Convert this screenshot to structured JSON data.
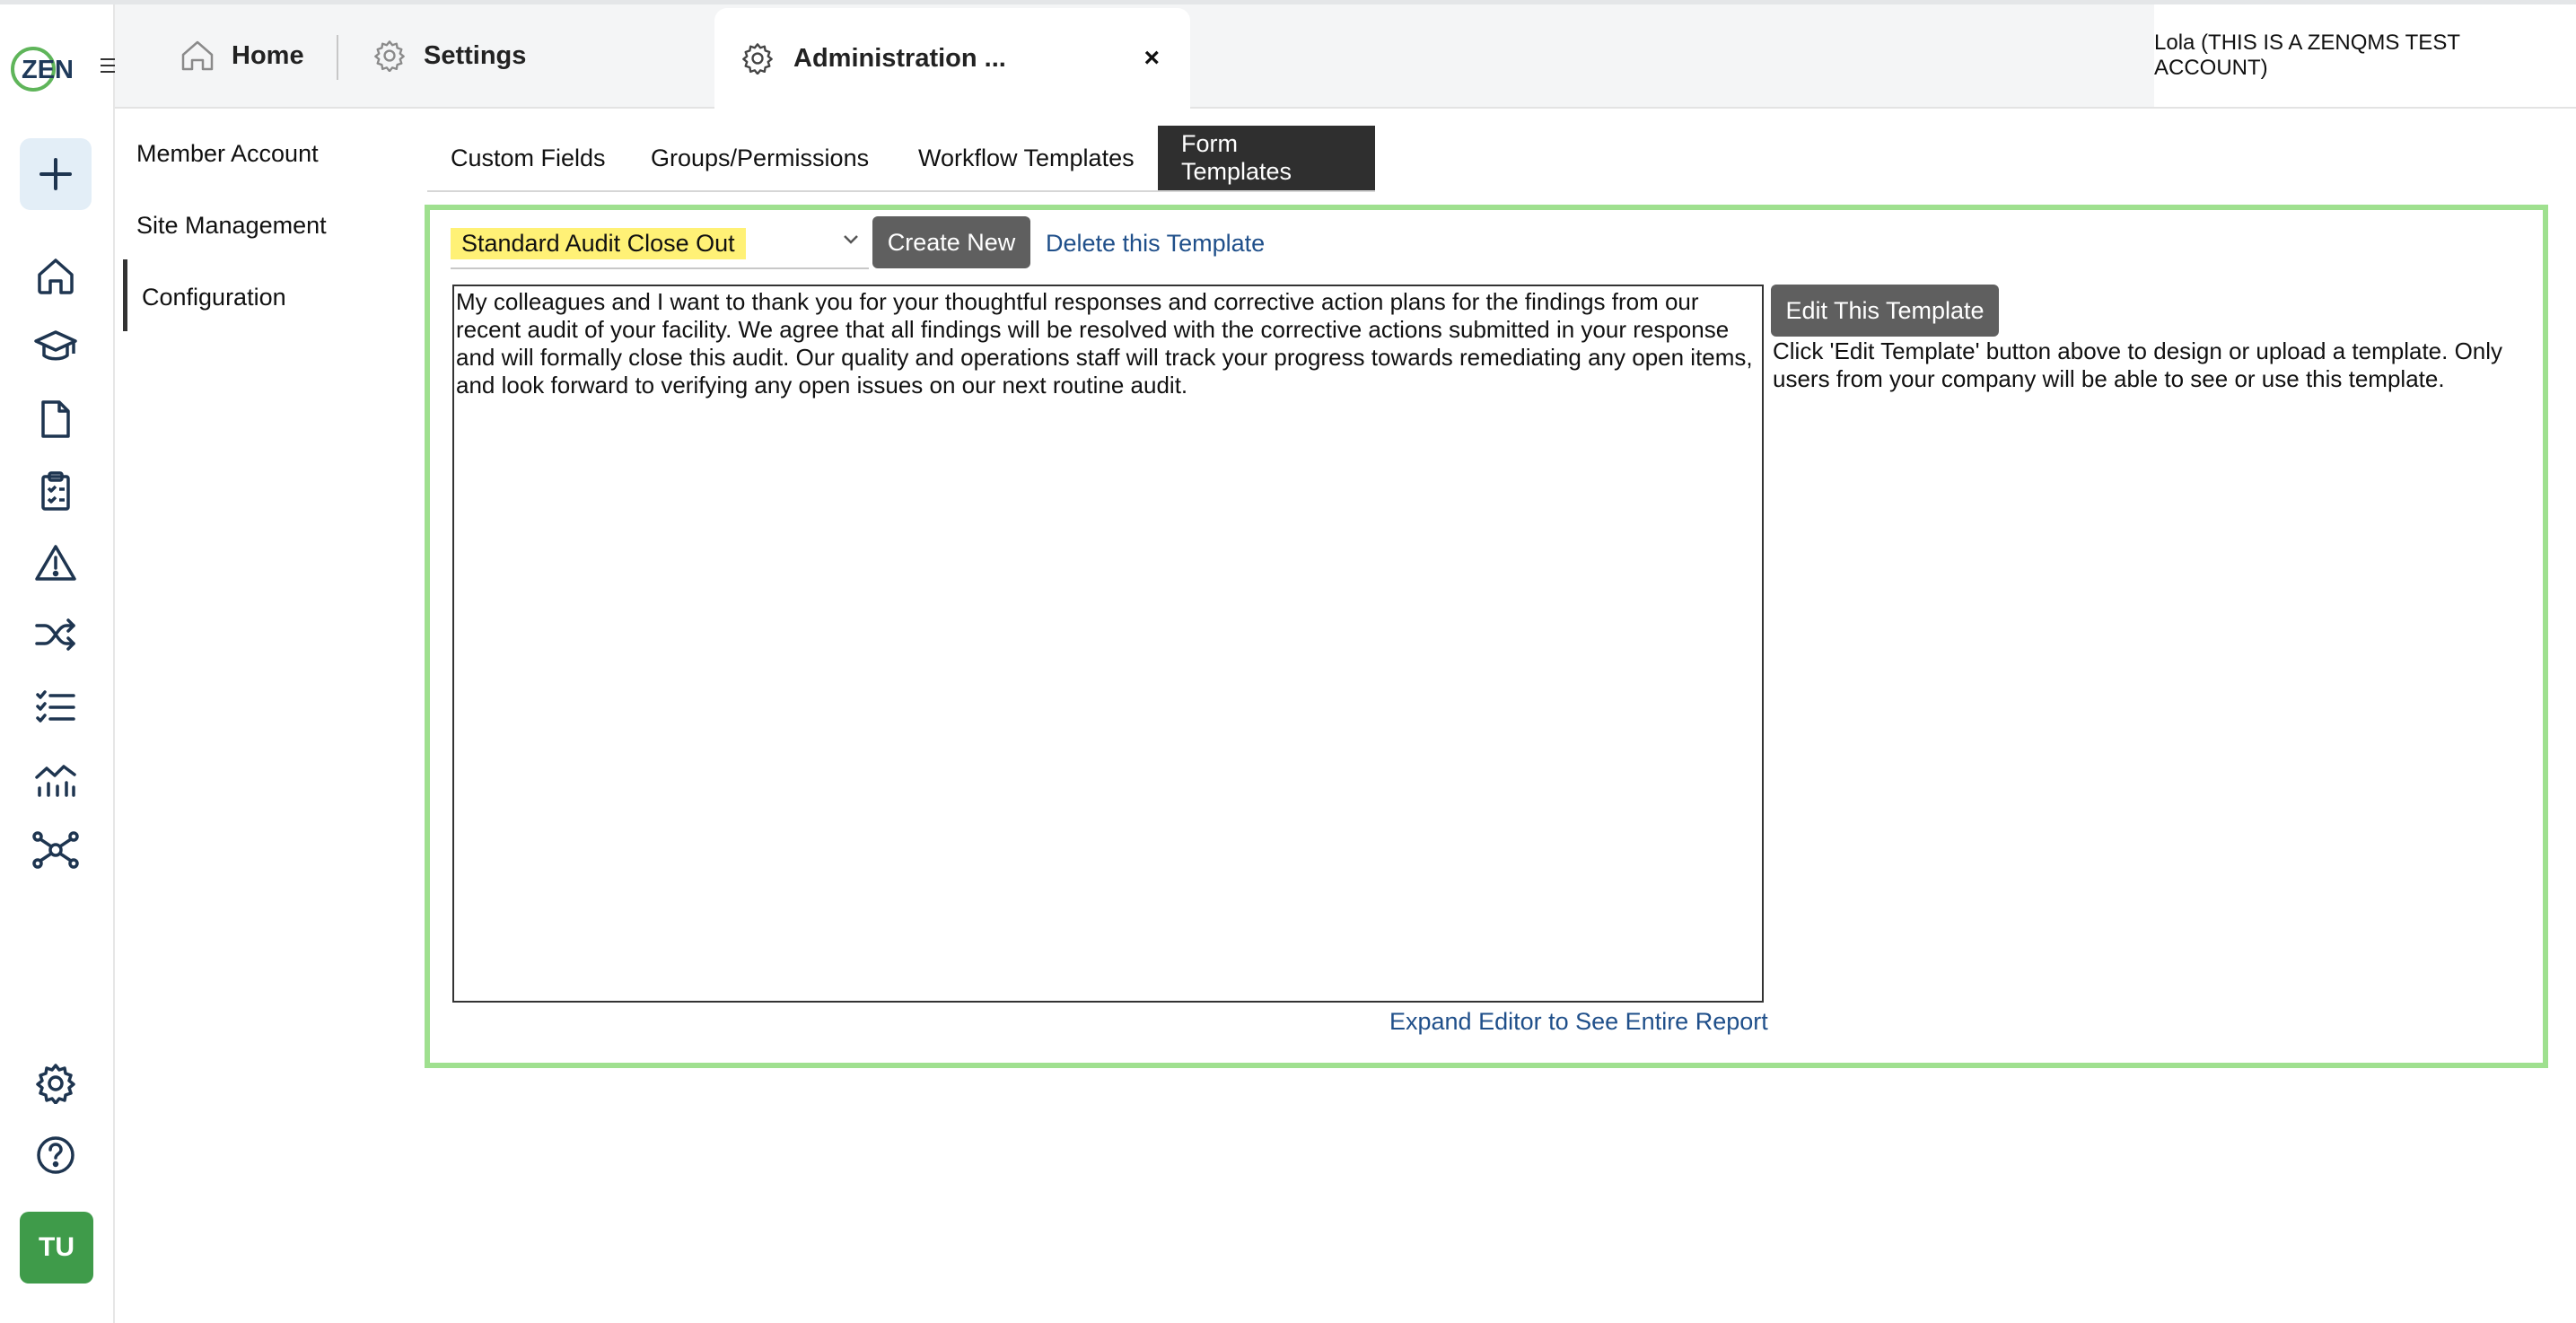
{
  "logo": {
    "text": "ZEN"
  },
  "rail": {
    "items": [
      {
        "name": "new-plus-icon"
      },
      {
        "name": "home-icon"
      },
      {
        "name": "training-cap-icon"
      },
      {
        "name": "documents-icon"
      },
      {
        "name": "audits-clipboard-icon"
      },
      {
        "name": "issues-warning-icon"
      },
      {
        "name": "workflow-shuffle-icon"
      },
      {
        "name": "checklist-icon"
      },
      {
        "name": "analytics-chart-icon"
      },
      {
        "name": "network-hub-icon"
      },
      {
        "name": "settings-gear-icon"
      },
      {
        "name": "help-question-icon"
      }
    ],
    "avatar_initials": "TU"
  },
  "tabs": {
    "home": "Home",
    "settings": "Settings",
    "admin": "Administration ...",
    "close": "×"
  },
  "user": {
    "label": "Lola (THIS IS A ZENQMS TEST ACCOUNT)"
  },
  "subnav": {
    "items": [
      "Member Account",
      "Site Management",
      "Configuration"
    ],
    "active": "Configuration"
  },
  "config_tabs": {
    "items": [
      "Custom Fields",
      "Groups/Permissions",
      "Workflow Templates",
      "Form Templates"
    ],
    "active": "Form Templates"
  },
  "form": {
    "selected_template": "Standard Audit Close Out",
    "create_new": "Create New",
    "delete_link": "Delete this Template",
    "body_text": "My colleagues and I want to thank you for your thoughtful responses and corrective action plans for the findings from our recent audit of your facility. We agree that all findings will be resolved with the corrective actions submitted in your response and will formally close this audit. Our quality and operations staff will track your progress towards remediating any open items, and look forward to verifying any open issues on our next routine audit.",
    "expand_link": "Expand Editor to See Entire Report",
    "edit_button": "Edit This Template",
    "help_text": "Click 'Edit Template' button above to design or upload a template. Only users from your company will be able to see or use this template."
  },
  "colors": {
    "accent_green": "#9fe08f",
    "avatar_green": "#3f9b4a",
    "highlight": "#fff176",
    "link": "#1f4f8a"
  }
}
